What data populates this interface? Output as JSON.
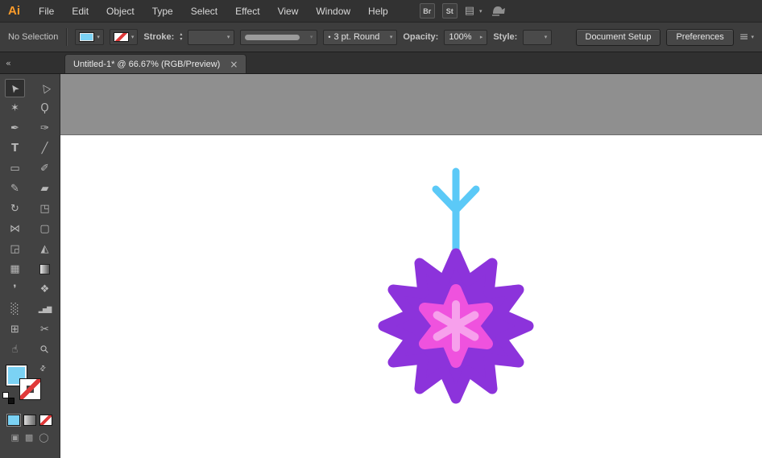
{
  "app": {
    "logo_text": "Ai",
    "menus": [
      "File",
      "Edit",
      "Object",
      "Type",
      "Select",
      "Effect",
      "View",
      "Window",
      "Help"
    ],
    "bridge_label": "Br",
    "stock_label": "St"
  },
  "control_bar": {
    "selection_status": "No Selection",
    "fill_color": "#7BD2F4",
    "stroke_label": "Stroke:",
    "brush_value": "3 pt. Round",
    "opacity_label": "Opacity:",
    "opacity_value": "100%",
    "style_label": "Style:",
    "document_setup_label": "Document Setup",
    "preferences_label": "Preferences"
  },
  "document": {
    "tab_title": "Untitled-1* @ 66.67% (RGB/Preview)"
  },
  "icons": {
    "collapse_panels": "«",
    "chevron_down": "▾",
    "spinner_up": "▴",
    "spinner_down": "▾",
    "spinner_right": "▸",
    "tab_close": "×",
    "workspace_switcher": "▤",
    "align": "≡",
    "bullet": "•",
    "swap_colors": "⇄",
    "selection_tool": "➤",
    "direct_selection_tool": "▷",
    "magic_wand_tool": "✶",
    "lasso_tool": "Ϙ",
    "pen_tool": "✒",
    "blob_brush_tool": "✑",
    "type_tool": "T",
    "line_tool": "╱",
    "rectangle_tool": "▭",
    "paintbrush_tool": "✐",
    "pencil_tool": "✎",
    "eraser_tool": "▰",
    "rotate_tool": "↻",
    "scale_tool": "◳",
    "width_tool": "⋈",
    "free_transform_tool": "▢",
    "shape_builder_tool": "◲",
    "perspective_grid_tool": "◭",
    "mesh_tool": "▦",
    "eyedropper_tool": "❜",
    "blend_tool": "❖",
    "symbol_sprayer_tool": "░",
    "column_graph_tool": "▂▅▇",
    "artboard_tool": "⊞",
    "slice_tool": "✂",
    "hand_tool": "☝",
    "zoom_tool": "⚲",
    "draw_normal": "▣",
    "draw_behind": "▩",
    "draw_inside": "◯"
  },
  "swatches": {
    "fill_color": "#7BD2F4",
    "stroke": "none"
  },
  "artwork": {
    "flower_star_color": "#8C33DB",
    "flower_inner_star_color": "#EF52DE",
    "flower_asterisk_color": "#F7A0EC",
    "stem_color": "#5BC9F7"
  }
}
